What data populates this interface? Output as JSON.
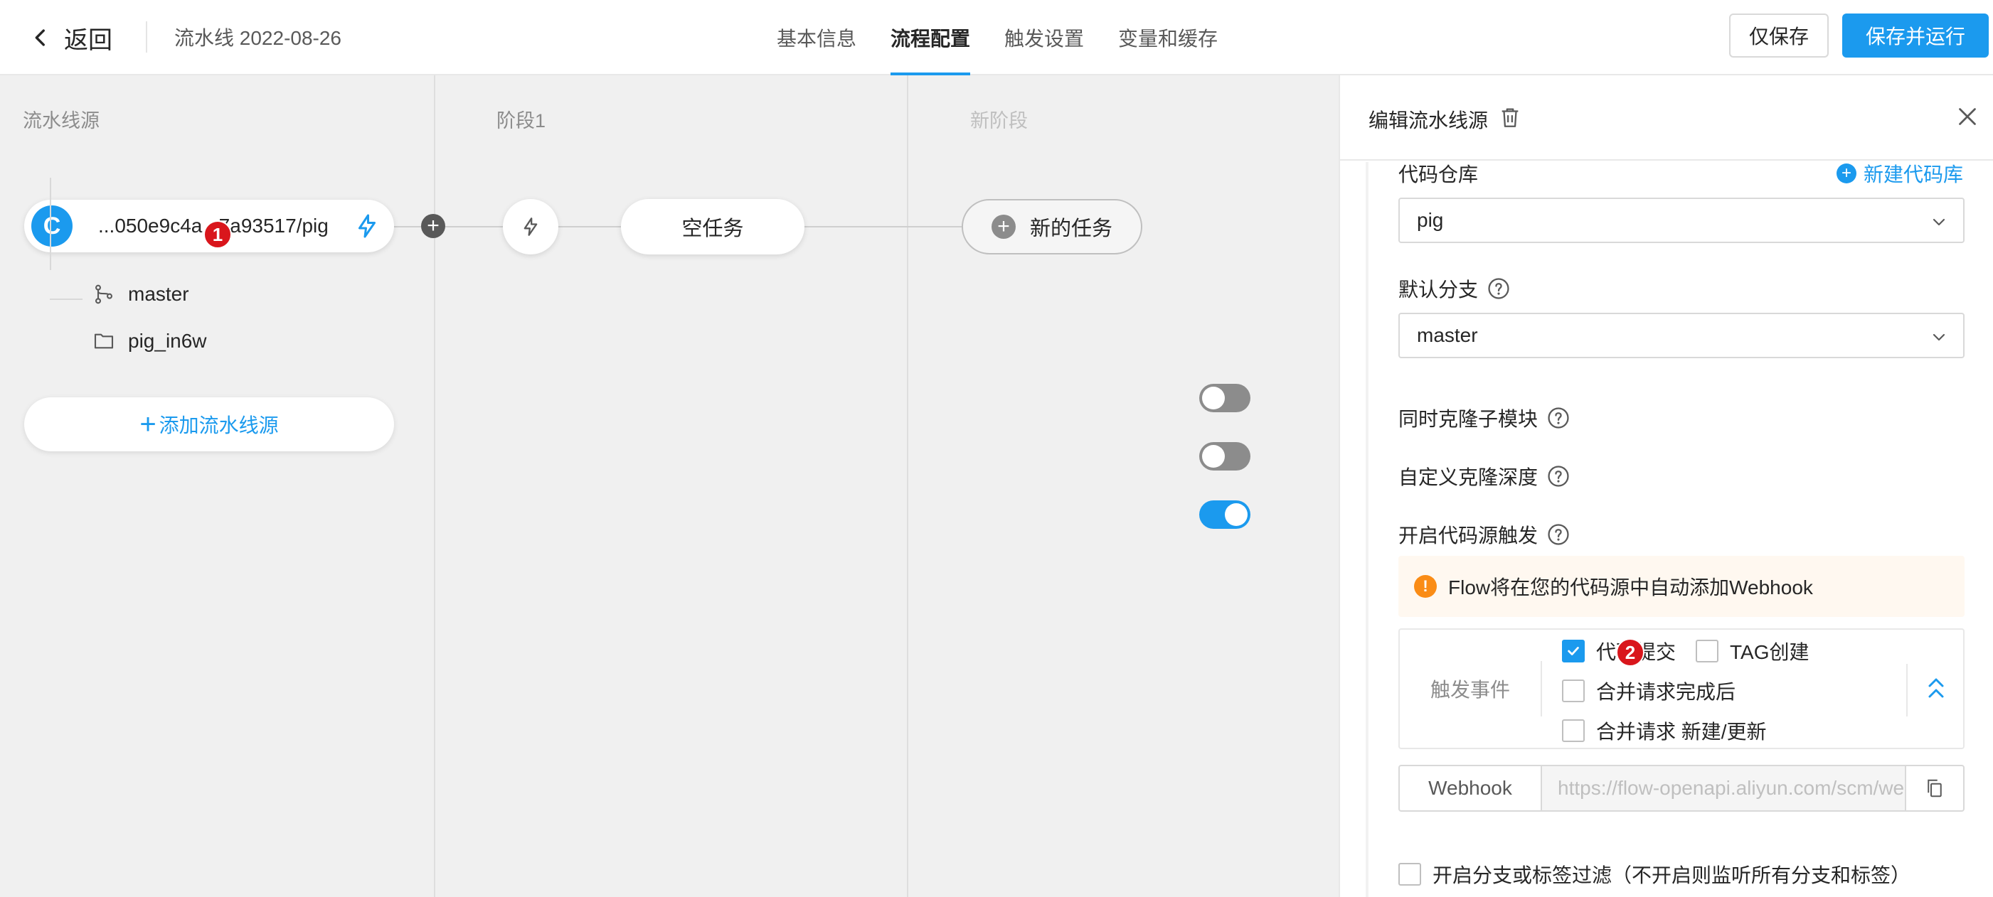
{
  "header": {
    "back_label": "返回",
    "pipeline_name": "流水线 2022-08-26",
    "tabs": [
      {
        "label": "基本信息",
        "active": false
      },
      {
        "label": "流程配置",
        "active": true
      },
      {
        "label": "触发设置",
        "active": false
      },
      {
        "label": "变量和缓存",
        "active": false
      }
    ],
    "save_only_label": "仅保存",
    "save_run_label": "保存并运行"
  },
  "canvas": {
    "columns": [
      "流水线源",
      "阶段1",
      "新阶段"
    ],
    "source": {
      "logo_letter": "C",
      "name": "...050e9c4a...7a93517/pig",
      "branch": "master",
      "folder": "pig_in6w"
    },
    "add_source_label": "添加流水线源",
    "task_empty_label": "空任务",
    "new_task_label": "新的任务",
    "markers": [
      "1",
      "2"
    ]
  },
  "panel": {
    "title": "编辑流水线源",
    "repo_label": "代码仓库",
    "new_repo_label": "新建代码库",
    "repo_value": "pig",
    "branch_label": "默认分支",
    "branch_value": "master",
    "clone_submodules_label": "同时克隆子模块",
    "clone_submodules_on": false,
    "custom_depth_label": "自定义克隆深度",
    "custom_depth_on": false,
    "source_trigger_label": "开启代码源触发",
    "source_trigger_on": true,
    "notice_text": "Flow将在您的代码源中自动添加Webhook",
    "events_label": "触发事件",
    "events": {
      "code_commit": "代码提交",
      "tag_create": "TAG创建",
      "mr_done": "合并请求完成后",
      "mr_new": "合并请求 新建/更新"
    },
    "webhook_label": "Webhook",
    "webhook_url": "https://flow-openapi.aliyun.com/scm/webhook",
    "filter_label": "开启分支或标签过滤（不开启则监听所有分支和标签）"
  },
  "colors": {
    "accent": "#1b9aee",
    "marker": "#d9161c",
    "warning": "#fa8c16"
  }
}
